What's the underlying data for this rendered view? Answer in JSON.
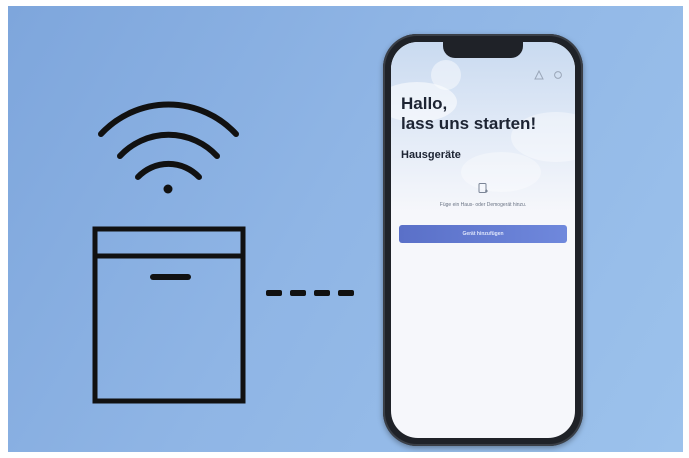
{
  "app": {
    "greeting_line1": "Hallo,",
    "greeting_line2": "lass uns starten!",
    "section_title": "Hausgeräte",
    "empty_message": "Füge ein Haus- oder Demogerät hinzu.",
    "add_button_label": "Gerät hinzufügen"
  },
  "colors": {
    "background": "#8fb5e5",
    "illustration_stroke": "#111111",
    "phone_frame": "#1f2228",
    "button": "#5a70c8",
    "heading_text": "#1d2433"
  },
  "icons": {
    "wifi": "wifi-icon",
    "appliance": "dishwasher-icon",
    "connection": "dashed-connection-line",
    "empty_state": "add-device-icon",
    "header_left": "notification-icon",
    "header_right": "settings-icon"
  }
}
